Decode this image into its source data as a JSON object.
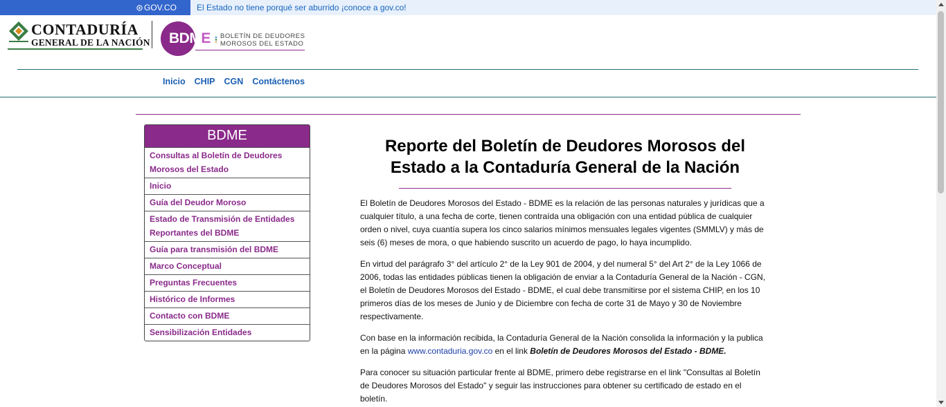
{
  "gov_bar": {
    "brand": "GOV.CO",
    "message": "El Estado no tiene porqué ser aburrido ¡conoce a gov.co!",
    "color": "#3366cc"
  },
  "header": {
    "cgn_logo_line1": "CONTADURÍA",
    "cgn_logo_line2": "GENERAL DE LA NACIÓN",
    "bdme_logo_word": "BDM",
    "bdme_logo_word_e": "E",
    "bdme_logo_sub1": "BOLETÍN DE DEUDORES",
    "bdme_logo_sub2": "MOROSOS DEL ESTADO"
  },
  "nav": [
    {
      "label": "Inicio"
    },
    {
      "label": "CHIP"
    },
    {
      "label": "CGN"
    },
    {
      "label": "Contáctenos"
    }
  ],
  "sidebar": {
    "title": "BDME",
    "items": [
      {
        "label": "Consultas al Boletín de Deudores Morosos del Estado"
      },
      {
        "label": "Inicio"
      },
      {
        "label": "Guía del Deudor Moroso"
      },
      {
        "label": "Estado de Transmisión de Entidades Reportantes del BDME"
      },
      {
        "label": "Guía para transmisión del BDME"
      },
      {
        "label": "Marco Conceptual"
      },
      {
        "label": "Preguntas Frecuentes"
      },
      {
        "label": "Histórico de Informes"
      },
      {
        "label": "Contacto con BDME"
      },
      {
        "label": "Sensibilización Entidades"
      }
    ]
  },
  "main": {
    "title": "Reporte del Boletín de Deudores Morosos del Estado a la Contaduría General de la Nación",
    "p1": "El Boletín de Deudores Morosos del Estado - BDME es la relación de las personas naturales y jurídicas que a cualquier título, a una fecha de corte, tienen contraída una obligación con una entidad pública de cualquier orden o nivel, cuya cuantía supera los cinco salarios mínimos mensuales legales vigentes (SMMLV) y más de seis (6) meses de mora, o que habiendo suscrito un acuerdo de pago, lo haya incumplido.",
    "p2": "En virtud del parágrafo 3° del artículo 2° de la Ley 901 de 2004, y del numeral 5° del Art 2° de la Ley 1066 de 2006, todas las entidades públicas tienen la obligación de enviar a la Contaduría General de la Nación - CGN, el Boletín de Deudores Morosos del Estado - BDME, el cual debe transmitirse por el sistema CHIP, en los 10 primeros días de los meses de Junio y de Diciembre con fecha de corte 31 de Mayo y 30 de Noviembre respectivamente.",
    "p3_a": "Con base en la información recibida, la Contaduría General de la Nación consolida la información y la publica en la página ",
    "p3_link": "www.contaduria.gov.co",
    "p3_b": " en el link ",
    "p3_bold": "Boletín de Deudores Morosos del Estado - BDME.",
    "p4": "Para conocer su situación particular frente al BDME, primero debe registrarse en el link \"Consultas al Boletín de Deudores Morosos del Estado\" y seguir las instrucciones para obtener su certificado de estado en el boletín."
  },
  "colors": {
    "purple": "#8a2a8a",
    "teal_rule": "#1f6e6e",
    "nav_link": "#1a5fb4"
  }
}
